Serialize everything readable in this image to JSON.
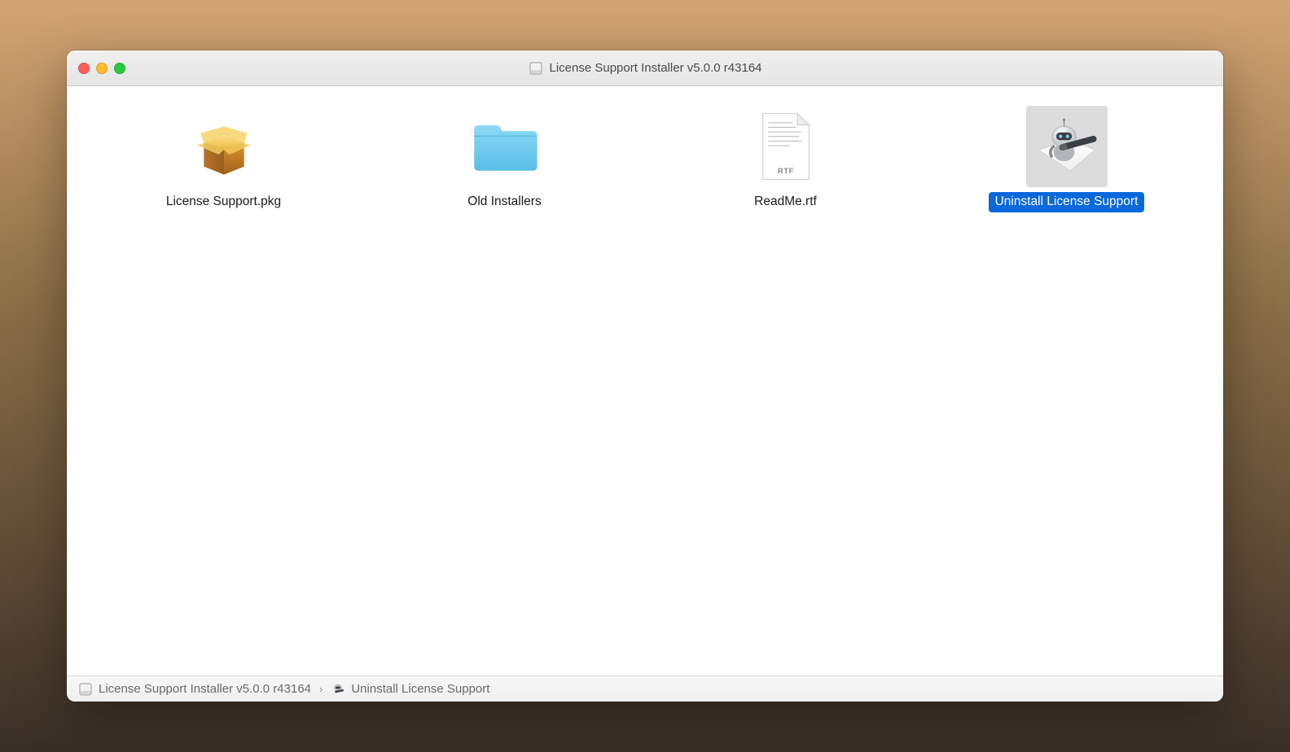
{
  "window": {
    "title": "License Support Installer v5.0.0 r43164"
  },
  "files": [
    {
      "name": "License Support.pkg",
      "icon": "package-icon",
      "selected": false
    },
    {
      "name": "Old Installers",
      "icon": "folder-icon",
      "selected": false
    },
    {
      "name": "ReadMe.rtf",
      "icon": "rtf-icon",
      "selected": false
    },
    {
      "name": "Uninstall License Support",
      "icon": "automator-icon",
      "selected": true
    }
  ],
  "pathbar": {
    "segments": [
      {
        "label": "License Support Installer v5.0.0 r43164",
        "icon": "disk-icon"
      },
      {
        "label": "Uninstall License Support",
        "icon": "automator-small-icon"
      }
    ]
  },
  "rtf_badge": "RTF"
}
